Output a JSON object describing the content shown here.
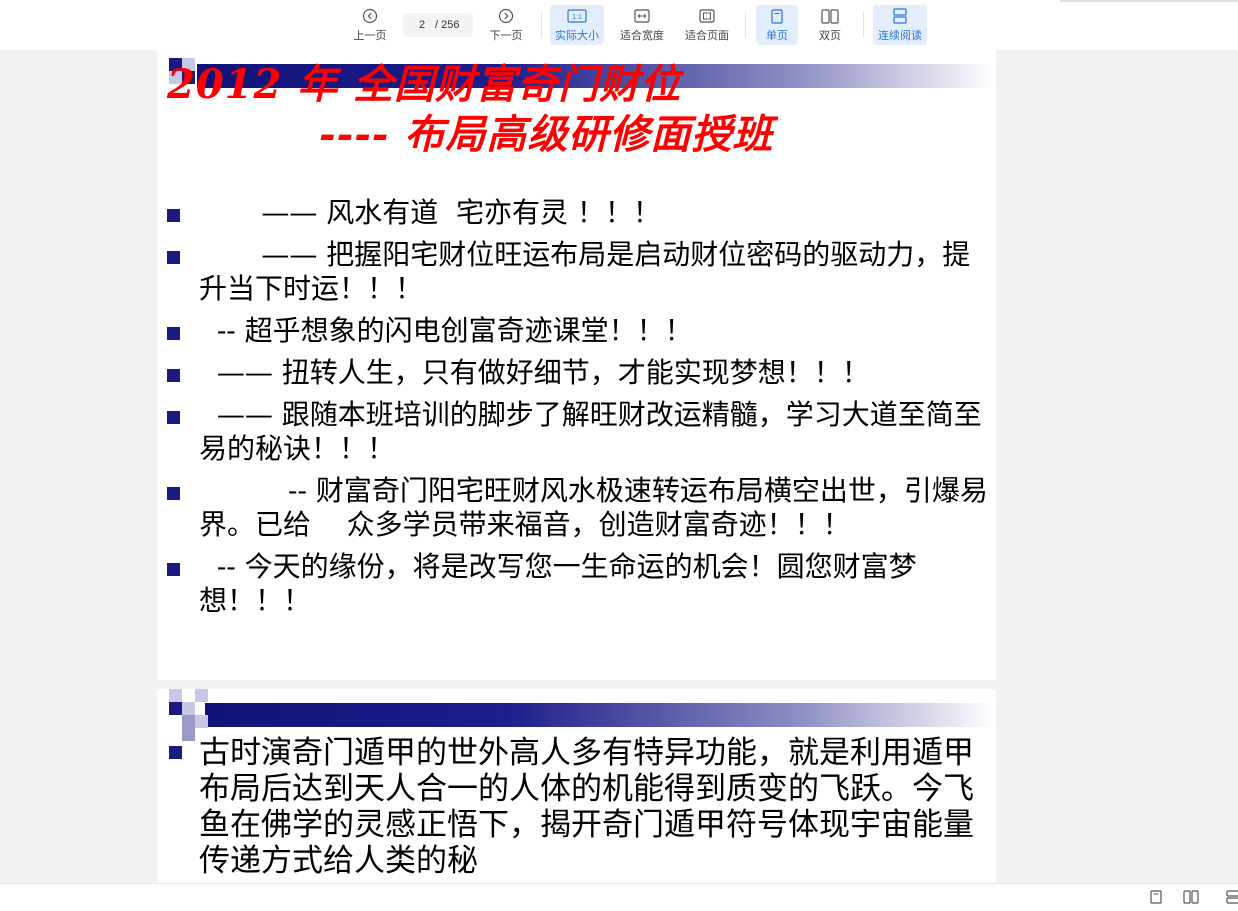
{
  "toolbar": {
    "prev_label": "上一页",
    "next_label": "下一页",
    "current_page": "2",
    "total_pages": "/ 256",
    "actual_size_label": "实际大小",
    "actual_size_icon_text": "1:1",
    "fit_width_label": "适合宽度",
    "fit_page_label": "适合页面",
    "single_page_label": "单页",
    "double_page_label": "双页",
    "continuous_label": "连续阅读",
    "accent_color": "#2a74d8"
  },
  "slide1": {
    "title_line1": "2012 年   全国财富奇门财位",
    "title_line2": "---- 布局高级研修面授班",
    "bullets": [
      "       —— 风水有道  宅亦有灵 ！！！",
      "       —— 把握阳宅财位旺运布局是启动财位密码的驱动力，提升当下时运！！！",
      "  -- 超乎想象的闪电创富奇迹课堂！！！",
      "  —— 扭转人生，只有做好细节，才能实现梦想！！！",
      "  —— 跟随本班培训的脚步了解旺财改运精髓，学习大道至简至易的秘诀！！！",
      "          -- 财富奇门阳宅旺财风水极速转运布局横空出世，引爆易界。已给    众多学员带来福音，创造财富奇迹！！！",
      "  -- 今天的缘份，将是改写您一生命运的机会！圆您财富梦想！！！"
    ],
    "title_color": "#ff0000",
    "band_color": "#1a1a80"
  },
  "slide2": {
    "text": "古时演奇门遁甲的世外高人多有特异功能，就是利用遁甲布局后达到天人合一的人体的机能得到质变的飞跃。今飞鱼在佛学的灵感正悟下，揭开奇门遁甲符号体现宇宙能量传递方式给人类的秘"
  },
  "statusbar": {
    "icons": [
      "single-page-icon",
      "double-page-icon",
      "layout-icon"
    ]
  }
}
